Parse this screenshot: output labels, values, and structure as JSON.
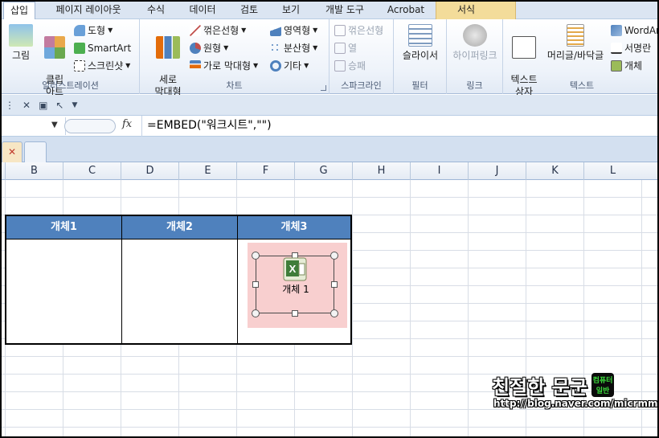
{
  "tabs": [
    "삽입",
    "페이지 레이아웃",
    "수식",
    "데이터",
    "검토",
    "보기",
    "개발 도구",
    "Acrobat",
    "서식"
  ],
  "groups": {
    "illustrations": {
      "label": "일러스트레이션",
      "picture": "그림",
      "clipart": "클립\n아트",
      "shapes": "도형",
      "smartart": "SmartArt",
      "screenshot": "스크린샷"
    },
    "charts": {
      "label": "차트",
      "column": "세로\n막대형",
      "line": "꺾은선형",
      "pie": "원형",
      "bar": "가로 막대형",
      "area": "영역형",
      "scatter": "분산형",
      "other": "기타"
    },
    "sparklines": {
      "label": "스파크라인",
      "line": "꺾은선형",
      "column": "열",
      "winloss": "승패"
    },
    "filter": {
      "label": "필터",
      "slicer": "슬라이서"
    },
    "links": {
      "label": "링크",
      "hyperlink": "하이퍼링크"
    },
    "text": {
      "label": "텍스트",
      "textbox": "텍스트\n상자",
      "headerfooter": "머리글/바닥글",
      "wordart": "WordArt",
      "signature": "서명란",
      "object": "개체"
    }
  },
  "formula_bar": {
    "fx": "fx",
    "formula": "=EMBED(\"워크시트\",\"\")"
  },
  "columns": [
    "B",
    "C",
    "D",
    "E",
    "F",
    "G",
    "H",
    "I",
    "J",
    "K",
    "L"
  ],
  "table": {
    "headers": [
      "개체1",
      "개체2",
      "개체3"
    ]
  },
  "embedded_object": {
    "label": "개체 1"
  },
  "watermark": {
    "title": "친절한 문군",
    "badge": [
      "컴퓨터",
      "일반"
    ],
    "url": "http://blog.naver.com/micrmm"
  },
  "colors": {
    "table_header": "#4f81bd",
    "embed_fill": "#f8cfcf"
  }
}
